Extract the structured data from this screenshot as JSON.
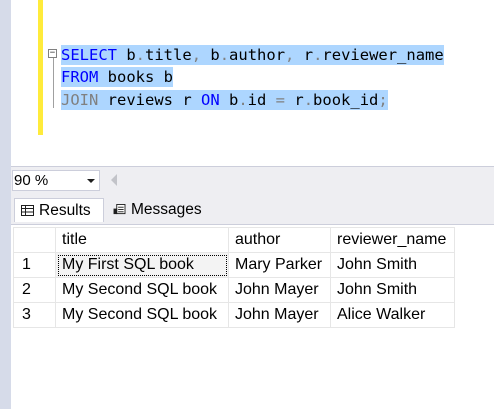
{
  "editor": {
    "lines": [
      {
        "tokens": [
          {
            "t": "SELECT",
            "c": "kw"
          },
          {
            "t": " b",
            "c": ""
          },
          {
            "t": ".",
            "c": "op"
          },
          {
            "t": "title",
            "c": ""
          },
          {
            "t": ",",
            "c": "op"
          },
          {
            "t": " b",
            "c": ""
          },
          {
            "t": ".",
            "c": "op"
          },
          {
            "t": "author",
            "c": ""
          },
          {
            "t": ",",
            "c": "op"
          },
          {
            "t": " r",
            "c": ""
          },
          {
            "t": ".",
            "c": "op"
          },
          {
            "t": "reviewer_name",
            "c": ""
          }
        ]
      },
      {
        "tokens": [
          {
            "t": "FROM",
            "c": "kw"
          },
          {
            "t": " books b",
            "c": ""
          }
        ]
      },
      {
        "tokens": [
          {
            "t": "JOIN",
            "c": "kw-gray"
          },
          {
            "t": " reviews r ",
            "c": ""
          },
          {
            "t": "ON",
            "c": "kw"
          },
          {
            "t": " b",
            "c": ""
          },
          {
            "t": ".",
            "c": "op"
          },
          {
            "t": "id ",
            "c": ""
          },
          {
            "t": "=",
            "c": "op"
          },
          {
            "t": " r",
            "c": ""
          },
          {
            "t": ".",
            "c": "op"
          },
          {
            "t": "book_id",
            "c": ""
          },
          {
            "t": ";",
            "c": "op"
          }
        ]
      }
    ],
    "collapse_symbol": "−"
  },
  "zoom": {
    "value": "90 %"
  },
  "tabs": {
    "results_label": "Results",
    "messages_label": "Messages"
  },
  "results": {
    "columns": [
      "title",
      "author",
      "reviewer_name"
    ],
    "rows": [
      {
        "n": "1",
        "title": "My First SQL book",
        "author": "Mary Parker",
        "reviewer_name": "John Smith"
      },
      {
        "n": "2",
        "title": "My Second SQL book",
        "author": "John Mayer",
        "reviewer_name": "John Smith"
      },
      {
        "n": "3",
        "title": "My Second SQL book",
        "author": "John Mayer",
        "reviewer_name": "Alice Walker"
      }
    ]
  },
  "colors": {
    "keyword": "#0000ff",
    "selection": "#add6ff",
    "change_marker": "#ffeb3b"
  }
}
